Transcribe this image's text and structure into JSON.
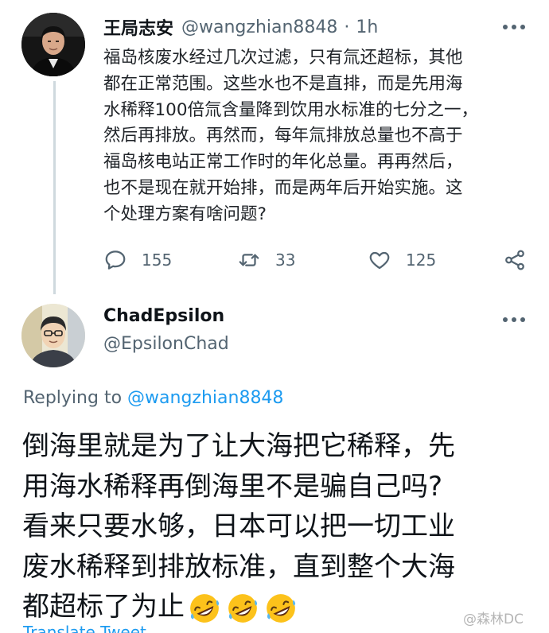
{
  "tweet": {
    "author_name": "王局志安",
    "author_handle": "@wangzhian8848",
    "separator": "·",
    "time": "1h",
    "body_lines": [
      "福岛核废水经过几次过滤，只有氚还超标，其他",
      "都在正常范围。这些水也不是直排，而是先用海",
      "水稀释100倍氚含量降到饮用水标准的七分之一，",
      "然后再排放。再然而，每年氚排放总量也不高于",
      "福岛核电站正常工作时的年化总量。再再然后，",
      "也不是现在就开始排，而是两年后开始实施。这",
      "个处理方案有啥问题?"
    ],
    "reply_count": "155",
    "retweet_count": "33",
    "like_count": "125",
    "icons": [
      "reply-icon",
      "retweet-icon",
      "like-icon",
      "share-icon",
      "more-icon"
    ]
  },
  "reply": {
    "author_name": "ChadEpsilon",
    "author_handle": "@EpsilonChad",
    "replying_prefix": "Replying to",
    "replying_to": "@wangzhian8848",
    "body_lines": [
      "倒海里就是为了让大海把它稀释，先",
      "用海水稀释再倒海里不是骗自己吗?",
      "看来只要水够，日本可以把一切工业",
      "废水稀释到排放标准，直到整个大海",
      "都超标了为止"
    ],
    "emojis": [
      "rofl-emoji",
      "rofl-emoji",
      "rofl-emoji"
    ],
    "translate_label": "Translate Tweet"
  },
  "watermark": "@森林DC",
  "colors": {
    "text": "#0f1419",
    "secondary": "#536471",
    "accent": "#1d9bf0",
    "thread_line": "#cfd9de"
  }
}
